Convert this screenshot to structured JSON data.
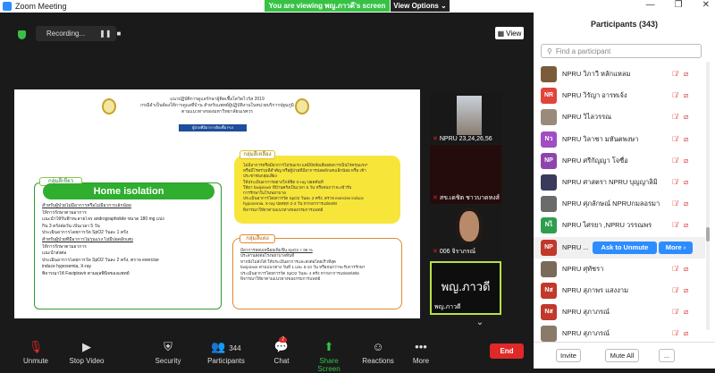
{
  "window": {
    "title": "Zoom Meeting",
    "controls": [
      "—",
      "❐",
      "✕"
    ]
  },
  "banner": {
    "viewing": "You are viewing พญ.ภาวดี's screen",
    "view_options": "View Options ⌄"
  },
  "meeting": {
    "recording": "Recording...",
    "view_label": "View"
  },
  "shared": {
    "header_line1": "แนวปฏิบัติการดูแลรักษาผู้ติดเชื้อโควิดไวรัส 2019",
    "header_line2": "กรณีจำเป็นต้องให้การดูแลที่บ้าน สำหรับแพทย์ผู้ปฏิบัติงานในหน่วยบริการปฐมภูมิ",
    "header_line3": "ตามแนวทางของมหาวิทยาลัยนเรศวร",
    "blue_bar": "ผู้ป่วยที่มีอาการติดเชื้อ PUI",
    "green_label": "กลุ่มสีเขียว",
    "green_title": "Home isolation",
    "green_lines": [
      "สำหรับผู้ป่วยไม่มีอาการหรือไม่มีอาการเล็กน้อย",
      "ให้การรักษาตามอาการ",
      "แนะนำให้รับฟ้าทะลายโจร andrographolide ขนาด 180 mg แบ่ง",
      "กิน 3 ครั้งต่อวัน เป็นเวลา 5 วัน",
      "ประเมินอาการโดยการวัด SpO2 วันละ 1 ครั้ง",
      "สำหรับผู้ป่วยที่มีอาการไม่รุนแรง ไม่มีปอดอักเสบ",
      "ให้การรักษาตามอาการ",
      "แนะนำส่งต่อ",
      "ประเมินอาการโดยการวัด SpO2 วันละ 2 ครั้ง, ตรวจ exercise",
      "induce hypoxemia, X-ray",
      "พิจารณาให้ Favipiravir ตามดุลพินิจของแพทย์"
    ],
    "yellow_label": "กลุ่มสีเหลือง",
    "yellow_lines": [
      "ไม่มีอาการหรือมีอาการไม่รุนแรง แต่มีปัจจัยเสี่ยงต่อการเป็นโรครุนแรง*",
      "หรือมีโรคร่วมที่สำคัญ หรือผู้ป่วยที่มีอาการปอดอักเสบเล็กน้อย หรือ เข้า",
      "ประชาชนกลุ่มเสี่ยง",
      "ให้ประเมินอาการอย่างใกล้ชิด X-ray ปอดทันที",
      "ให้ยา favipiravir ที่บ้านครั้งเป็นเวลา 5 วัน หรือจนกว่าจะเข้ารับ",
      "การรักษาในโรงพยาบาล",
      "ประเมินอาการโดยการวัด SpO2 วันละ 2 ครั้ง, ตรวจ exercise induce",
      "hypoxemia, X-ray ปอดทุก 2-3 วัน หากอาการแย่ลงส่ง",
      "พิจารณาให้ยาตามแนวทางของกรมการแพทย์"
    ],
    "orange_label": "กลุ่มสีแดง",
    "orange_lines": [
      "มีอาการหอบเหนื่อยเพิ่มขึ้น SpO2 < 96 %",
      "ประสานส่งต่อโรงพยาบาลทันที",
      "หากยังไม่ส่งได้ ให้ประเมินอาการและส่งต่อโดยเร็วที่สุด",
      "favipiravir ตามแนวทาง วันที่ 1 และ 5-10 วัน หรือจนกว่าจะรับการรักษา",
      "ประเมินอาการโดยการวัด SpO2 วันละ 4 ครั้ง หากอาการแย่ลงส่งต่อ",
      "พิจารณาให้ยาตามแนวทางของกรมการแพทย์"
    ]
  },
  "thumbnails": [
    {
      "name": "NPRU 23,24,26,56"
    },
    {
      "name": "สข.เดชิต ชาวบาดหงส์"
    },
    {
      "name": "006 จิราภรณ์"
    },
    {
      "name": "พญ.ภาวดี",
      "big": "พญ.ภาวดี"
    }
  ],
  "toolbar": {
    "unmute": "Unmute",
    "stop_video": "Stop Video",
    "security": "Security",
    "participants": "Participants",
    "participants_count": "344",
    "chat": "Chat",
    "chat_badge": "7",
    "share_screen": "Share Screen",
    "reactions": "Reactions",
    "more": "More",
    "end": "End"
  },
  "panel": {
    "title": "Participants (343)",
    "search_placeholder": "Find a participant",
    "participants": [
      {
        "initials": "",
        "name": "NPRU วิภาวี หลักแหลม",
        "color": "#7a5c3a"
      },
      {
        "initials": "NR",
        "name": "NPRU วิรัญา อารทเจ้ง",
        "color": "#e0443a"
      },
      {
        "initials": "",
        "name": "NPRU วิไลวรรณ",
        "color": "#9a8a7a"
      },
      {
        "initials": "Nว",
        "name": "NPRU วิลาชา มหันตพงษา",
        "color": "#a04ec2"
      },
      {
        "initials": "NP",
        "name": "NPRU ศรีกัญญา โจซื่อ",
        "color": "#8e44ad"
      },
      {
        "initials": "",
        "name": "NPRU ศาสตรา NPRU บุญญาลิมิ",
        "color": "#3a3a5a"
      },
      {
        "initials": "",
        "name": "NPRU ศุภลักษณ์ NPRUกมลอรมา",
        "color": "#6b6b6b"
      },
      {
        "initials": "Nไ",
        "name": "NPRU ไศรยา ,NPRU วรรณพร",
        "color": "#2e9e4e"
      },
      {
        "initials": "NP",
        "name": "NPRU ...",
        "color": "#c0392b"
      },
      {
        "initials": "",
        "name": "NPRU ศุทัชรา",
        "color": "#7a6a5a"
      },
      {
        "initials": "Nส",
        "name": "NPRU สุภาพร  แสงงาม",
        "color": "#c0392b"
      },
      {
        "initials": "Nส",
        "name": "NPRU สุภาภรณ์",
        "color": "#c0392b"
      },
      {
        "initials": "",
        "name": "NPRU สุภาภรณ์",
        "color": "#8a7a6a"
      }
    ],
    "ask_to_unmute": "Ask to Unmute",
    "more": "More ›",
    "invite": "Invite",
    "mute_all": "Mute All",
    "more_menu": "..."
  }
}
